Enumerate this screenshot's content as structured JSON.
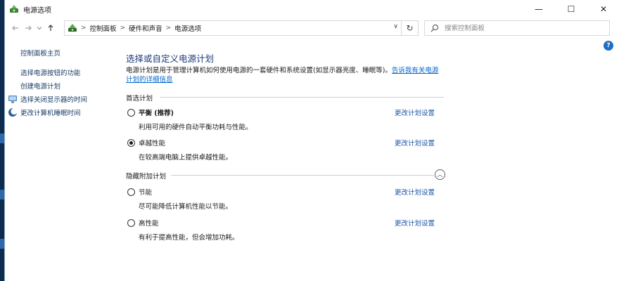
{
  "window": {
    "title": "电源选项",
    "controls": {
      "minimize": "—",
      "maximize": "☐",
      "close": "✕"
    }
  },
  "nav": {
    "back_icon": "arrow-left-icon",
    "forward_icon": "arrow-right-icon",
    "recent_icon": "chevron-down-icon",
    "up_icon": "arrow-up-icon",
    "breadcrumbs": [
      "控制面板",
      "硬件和声音",
      "电源选项"
    ],
    "separator": ">",
    "dropdown": "∨",
    "refresh": "↻",
    "search_placeholder": "搜索控制面板"
  },
  "sidebar": {
    "home": "控制面板主页",
    "items": [
      {
        "label": "选择电源按钮的功能",
        "icon": null
      },
      {
        "label": "创建电源计划",
        "icon": null
      },
      {
        "label": "选择关闭显示器的时间",
        "icon": "monitor-icon"
      },
      {
        "label": "更改计算机睡眠时间",
        "icon": "moon-icon"
      }
    ]
  },
  "main": {
    "title": "选择或自定义电源计划",
    "description": "电源计划是用于管理计算机如何使用电源的一套硬件和系统设置(如显示器亮度、睡眠等)。",
    "description_link": "告诉我有关电源计划的详细信息",
    "preferred_group": "首选计划",
    "hidden_group": "隐藏附加计划",
    "change_link": "更改计划设置",
    "plans": [
      {
        "name": "平衡 (推荐)",
        "desc": "利用可用的硬件自动平衡功耗与性能。",
        "selected": false
      },
      {
        "name": "卓越性能",
        "desc": "在较高端电脑上提供卓越性能。",
        "selected": true
      },
      {
        "name": "节能",
        "desc": "尽可能降低计算机性能以节能。",
        "selected": false
      },
      {
        "name": "高性能",
        "desc": "有利于提高性能，但会增加功耗。",
        "selected": false
      }
    ],
    "collapse_icon": "︿"
  },
  "help": "?",
  "colors": {
    "link": "#1a55a8",
    "title": "#1e3a7a",
    "help": "#1f6fc5"
  }
}
